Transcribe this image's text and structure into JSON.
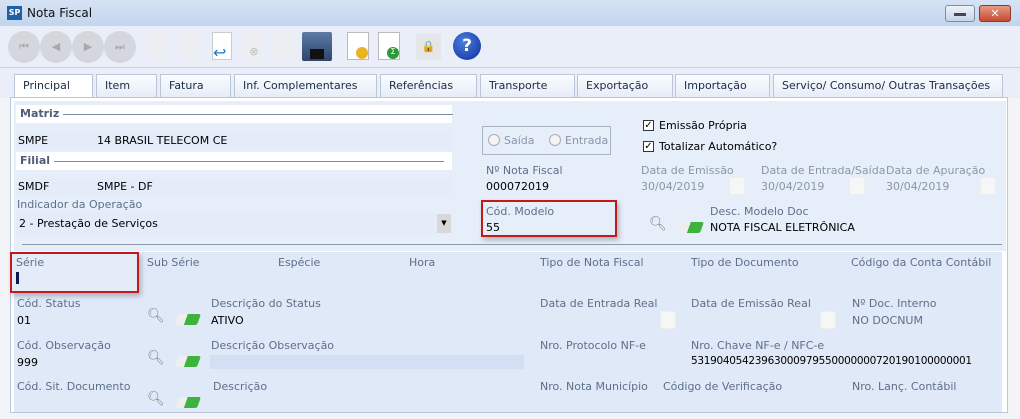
{
  "window": {
    "title": "Nota Fiscal",
    "app_badge": "SP"
  },
  "tabs": [
    "Principal",
    "Item",
    "Fatura",
    "Inf. Complementares",
    "Referências",
    "Transporte",
    "Exportação",
    "Importação",
    "Serviço/ Consumo/ Outras Transações"
  ],
  "matriz": {
    "header": "Matriz",
    "code": "SMPE",
    "name": "14 BRASIL TELECOM CE"
  },
  "filial": {
    "header": "Filial",
    "code": "SMDF",
    "name": "SMPE - DF"
  },
  "indicador": {
    "label": "Indicador da Operação",
    "value": "2 - Prestação de Serviços"
  },
  "radio": {
    "saida": "Saída",
    "entrada": "Entrada"
  },
  "checks": {
    "emissao": "Emissão Própria",
    "totalizar": "Totalizar Automático?"
  },
  "nota": {
    "label": "Nº Nota Fiscal",
    "value": "000072019"
  },
  "datas": {
    "emissao_label": "Data de Emissão",
    "emissao": "30/04/2019",
    "entrada_label": "Data de Entrada/Saída",
    "entrada": "30/04/2019",
    "apuracao_label": "Data de Apuração",
    "apuracao": "30/04/2019"
  },
  "modelo": {
    "label": "Cód. Modelo",
    "value": "55",
    "desc_label": "Desc. Modelo Doc",
    "desc": "NOTA FISCAL ELETRÔNICA"
  },
  "row1": {
    "serie": "Série",
    "sub_serie": "Sub Série",
    "especie": "Espécie",
    "hora": "Hora",
    "tipo_nf": "Tipo de Nota Fiscal",
    "tipo_doc": "Tipo de Documento",
    "conta": "Código da Conta Contábil"
  },
  "row2": {
    "status_label": "Cód. Status",
    "status": "01",
    "desc_label": "Descrição do Status",
    "desc": "ATIVO",
    "entrada_real": "Data de Entrada Real",
    "emissao_real": "Data de Emissão Real",
    "doc_label": "Nº Doc. Interno",
    "doc": "NO DOCNUM"
  },
  "row3": {
    "obs_label": "Cód. Observação",
    "obs": "999",
    "desc_label": "Descrição Observação",
    "protocolo": "Nro. Protocolo NF-e",
    "chave_label": "Nro. Chave NF-e / NFC-e",
    "chave": "53190405423963000979550000000720190100000001"
  },
  "row4": {
    "sit_label": "Cód. Sit. Documento",
    "desc_label": "Descrição",
    "municipio": "Nro. Nota Município",
    "verificacao": "Código de Verificação",
    "lanc": "Nro. Lanç. Contábil"
  }
}
